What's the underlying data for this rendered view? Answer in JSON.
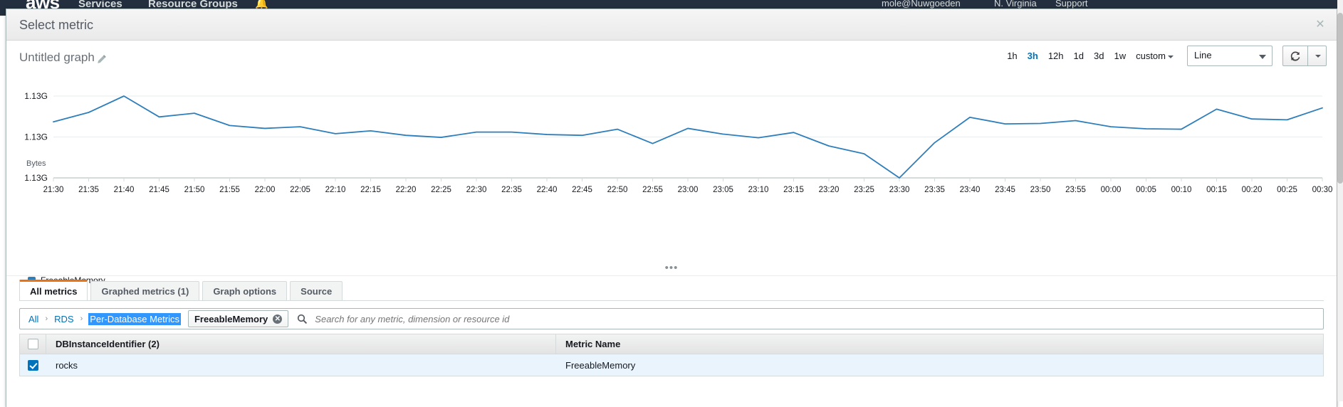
{
  "console_bg": {
    "logo": "aws",
    "nav": [
      "Services",
      "Resource Groups"
    ],
    "bell_icon": "bell-icon",
    "right_items": [
      "mole@Nuwgoeden",
      "N. Virginia",
      "Support"
    ]
  },
  "modal": {
    "title": "Select metric",
    "close_icon": "close-icon"
  },
  "graph": {
    "title": "Untitled graph",
    "edit_icon": "pencil-icon",
    "drag_handle": "•••"
  },
  "time_range": {
    "options": [
      "1h",
      "3h",
      "12h",
      "1d",
      "3d",
      "1w"
    ],
    "selected": "3h",
    "custom_label": "custom",
    "custom_caret_icon": "chevron-down-icon"
  },
  "chart_type": {
    "selected": "Line",
    "arrow_icon": "chevron-down-icon"
  },
  "toolbar": {
    "refresh_icon": "refresh-icon",
    "refresh_caret_icon": "chevron-down-icon"
  },
  "tabs": [
    {
      "label": "All metrics",
      "active": true
    },
    {
      "label": "Graphed metrics (1)",
      "active": false
    },
    {
      "label": "Graph options",
      "active": false
    },
    {
      "label": "Source",
      "active": false
    }
  ],
  "breadcrumb": {
    "items": [
      "All",
      "RDS",
      "Per-Database Metrics"
    ],
    "separator": "❯",
    "highlighted_index": 2
  },
  "filter_token": {
    "label": "FreeableMemory",
    "remove_icon": "close-circle-icon"
  },
  "search": {
    "icon": "search-icon",
    "placeholder": "Search for any metric, dimension or resource id",
    "value": ""
  },
  "table": {
    "select_all_checked": false,
    "columns": [
      "DBInstanceIdentifier  (2)",
      "Metric Name"
    ],
    "rows": [
      {
        "checked": true,
        "dbinstance": "rocks",
        "metric_name": "FreeableMemory"
      }
    ]
  },
  "colors": {
    "series": "#2e7ebb",
    "accent": "#ec7211",
    "link": "#0073bb",
    "selection": "#3297fd",
    "row_selected": "#e9f4fc"
  },
  "chart_data": {
    "type": "line",
    "title": "Untitled graph",
    "xlabel": "",
    "ylabel": "Bytes",
    "ylim": [
      0,
      1
    ],
    "grid": true,
    "legend_position": "bottom-left",
    "y_tick_labels": [
      "1.13G",
      "1.13G",
      "1.13G"
    ],
    "x": [
      "21:30",
      "21:35",
      "21:40",
      "21:45",
      "21:50",
      "21:55",
      "22:00",
      "22:05",
      "22:10",
      "22:15",
      "22:20",
      "22:25",
      "22:30",
      "22:35",
      "22:40",
      "22:45",
      "22:50",
      "22:55",
      "23:00",
      "23:05",
      "23:10",
      "23:15",
      "23:20",
      "23:25",
      "23:30",
      "23:35",
      "23:40",
      "23:45",
      "23:50",
      "23:55",
      "00:00",
      "00:05",
      "00:10",
      "00:15",
      "00:20",
      "00:25",
      "00:30"
    ],
    "series": [
      {
        "name": "FreeableMemory",
        "color": "#2e7ebb",
        "values": [
          0.685,
          0.8,
          1.0,
          0.745,
          0.79,
          0.64,
          0.605,
          0.625,
          0.54,
          0.575,
          0.52,
          0.495,
          0.56,
          0.56,
          0.53,
          0.52,
          0.595,
          0.42,
          0.605,
          0.535,
          0.49,
          0.555,
          0.39,
          0.295,
          0.0,
          0.43,
          0.74,
          0.66,
          0.665,
          0.7,
          0.625,
          0.6,
          0.595,
          0.84,
          0.72,
          0.71,
          0.855
        ]
      }
    ]
  }
}
